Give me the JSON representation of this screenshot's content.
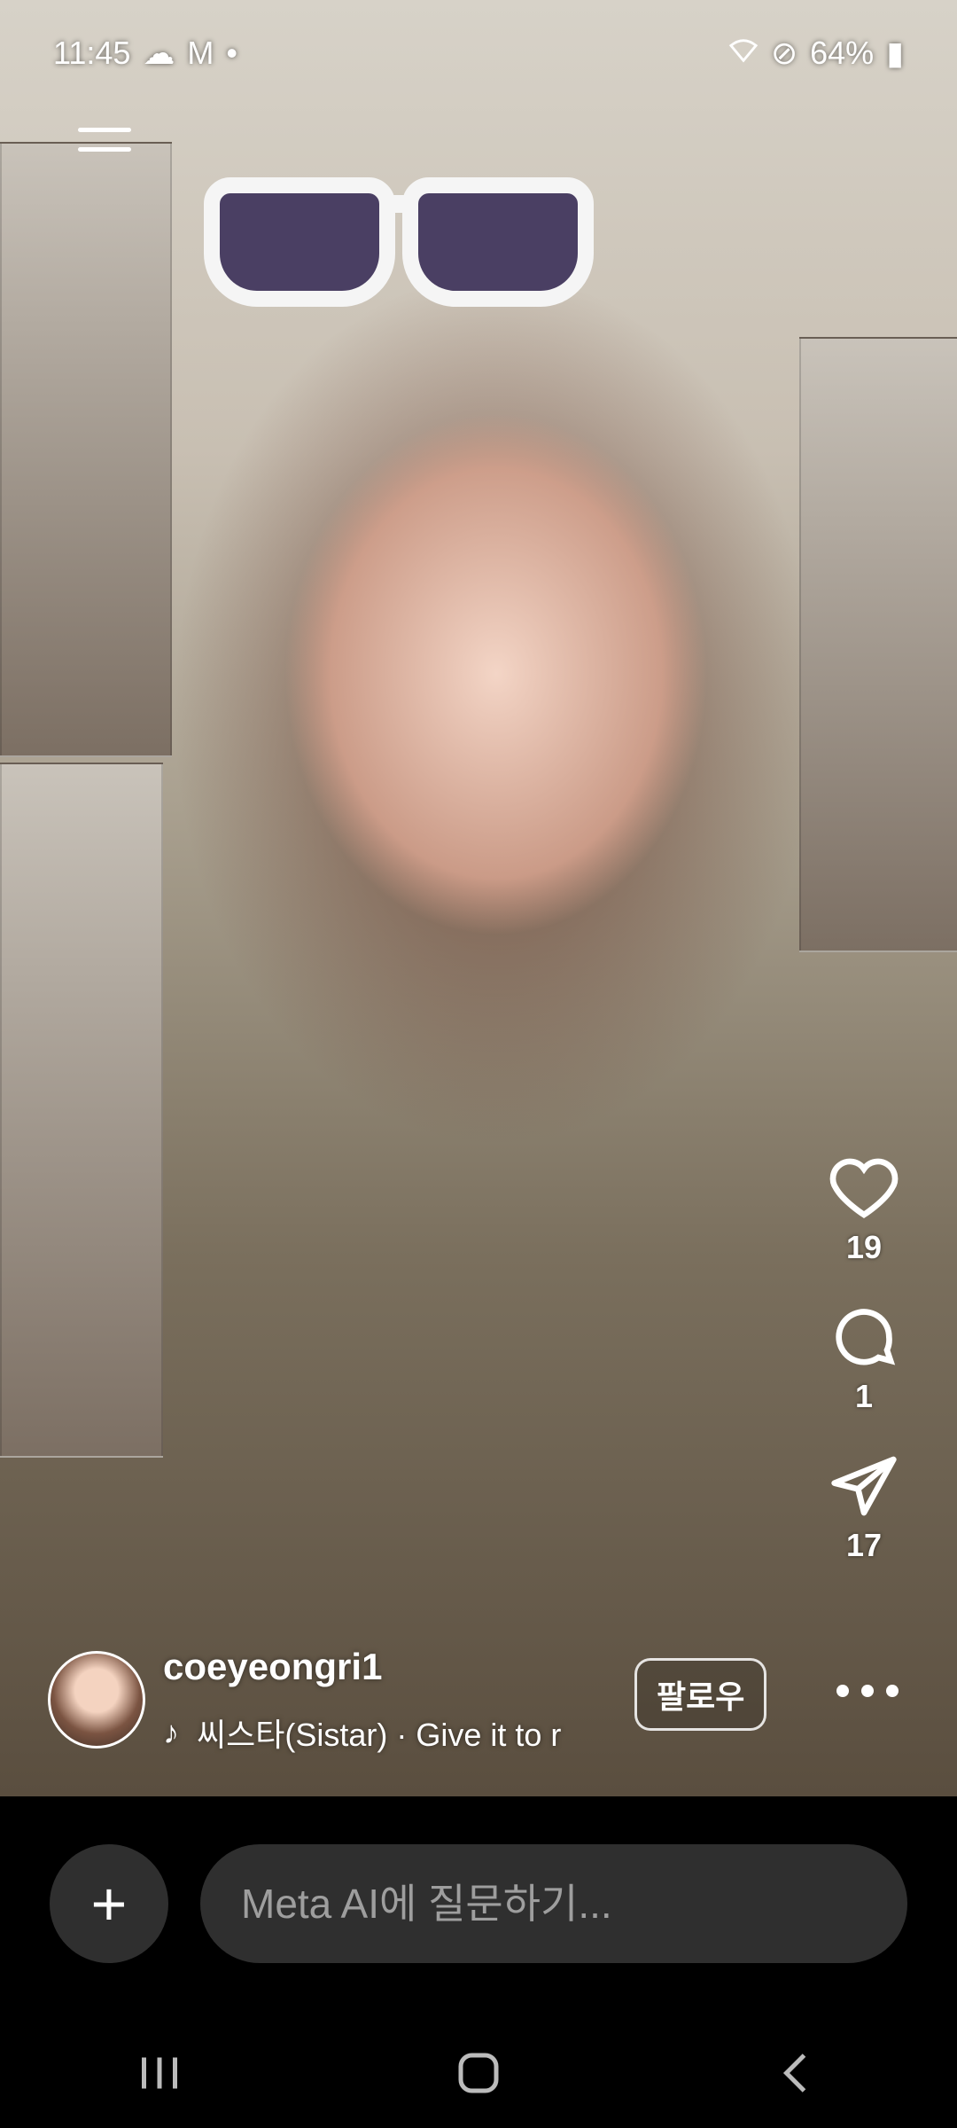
{
  "status": {
    "time": "11:45",
    "battery": "64%"
  },
  "actions": {
    "likes": "19",
    "comments": "1",
    "shares": "17"
  },
  "owner": {
    "username": "coeyeongri1",
    "music": "씨스타(Sistar) · Give it to r",
    "follow_label": "팔로우"
  },
  "ai": {
    "placeholder": "Meta AI에 질문하기..."
  },
  "colors": {
    "background": "#000000",
    "input_bg": "#2f2f2f",
    "text": "#ffffff"
  },
  "icons": {
    "status_left": [
      "cloud-icon",
      "gmail-icon",
      "notification-dot-icon"
    ],
    "status_right": [
      "wifi-icon",
      "dnd-icon",
      "battery-icon"
    ],
    "actions": [
      "heart-icon",
      "comment-icon",
      "send-icon"
    ],
    "navbar": [
      "recent-apps-icon",
      "home-icon",
      "back-icon"
    ]
  }
}
